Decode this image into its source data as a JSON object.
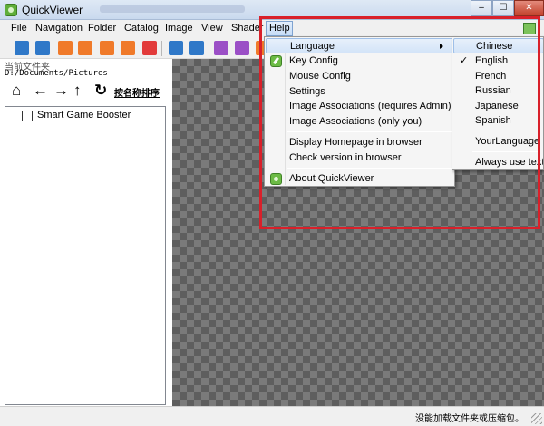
{
  "window": {
    "title": "QuickViewer",
    "min_glyph": "–",
    "max_glyph": "☐",
    "close_glyph": "✕"
  },
  "menubar": {
    "items": [
      "File",
      "Navigation",
      "Folder",
      "Catalog",
      "Image",
      "View",
      "Shader"
    ],
    "help": "Help"
  },
  "sidebar": {
    "path_label": "当前文件夹",
    "path_value": "D:/Documents/Pictures",
    "nav_icons": [
      "home-icon",
      "arrow-left-icon",
      "arrow-right-icon",
      "arrow-up-icon",
      "refresh-icon"
    ],
    "nav_glyphs": [
      "⌂",
      "←",
      "→",
      "↑",
      "↻"
    ],
    "sort_label": "按名称排序",
    "tree_items": [
      {
        "label": "Smart Game Booster",
        "checked": false
      }
    ]
  },
  "help_menu": {
    "items": [
      {
        "label": "Language",
        "submenu": true,
        "icon": "",
        "highlighted": true
      },
      {
        "label": "Key Config",
        "submenu": false,
        "icon": "key-icon"
      },
      {
        "label": "Mouse Config",
        "submenu": false,
        "icon": ""
      },
      {
        "label": "Settings",
        "submenu": false,
        "icon": ""
      },
      {
        "label": "Image Associations (requires Admin)",
        "submenu": false,
        "icon": ""
      },
      {
        "label": "Image Associations (only you)",
        "submenu": false,
        "icon": ""
      },
      {
        "label": "Display Homepage in browser",
        "submenu": false,
        "icon": ""
      },
      {
        "label": "Check version in browser",
        "submenu": false,
        "icon": ""
      },
      {
        "label": "About QuickViewer",
        "submenu": false,
        "icon": "about-icon"
      }
    ]
  },
  "language_submenu": {
    "items": [
      {
        "label": "Chinese",
        "checked": false,
        "highlighted": true
      },
      {
        "label": "English",
        "checked": true
      },
      {
        "label": "French",
        "checked": false
      },
      {
        "label": "Russian",
        "checked": false
      },
      {
        "label": "Japanese",
        "checked": false
      },
      {
        "label": "Spanish",
        "checked": false
      },
      {
        "label": "YourLanguage",
        "checked": false
      },
      {
        "label": "Always use text",
        "checked": false
      }
    ]
  },
  "statusbar": {
    "text": "没能加载文件夹或压缩包。"
  },
  "colors": {
    "highlight_box": "#d9202a",
    "menu_highlight": "#d3e4f8",
    "app_icon_green": "#5fae3a"
  }
}
